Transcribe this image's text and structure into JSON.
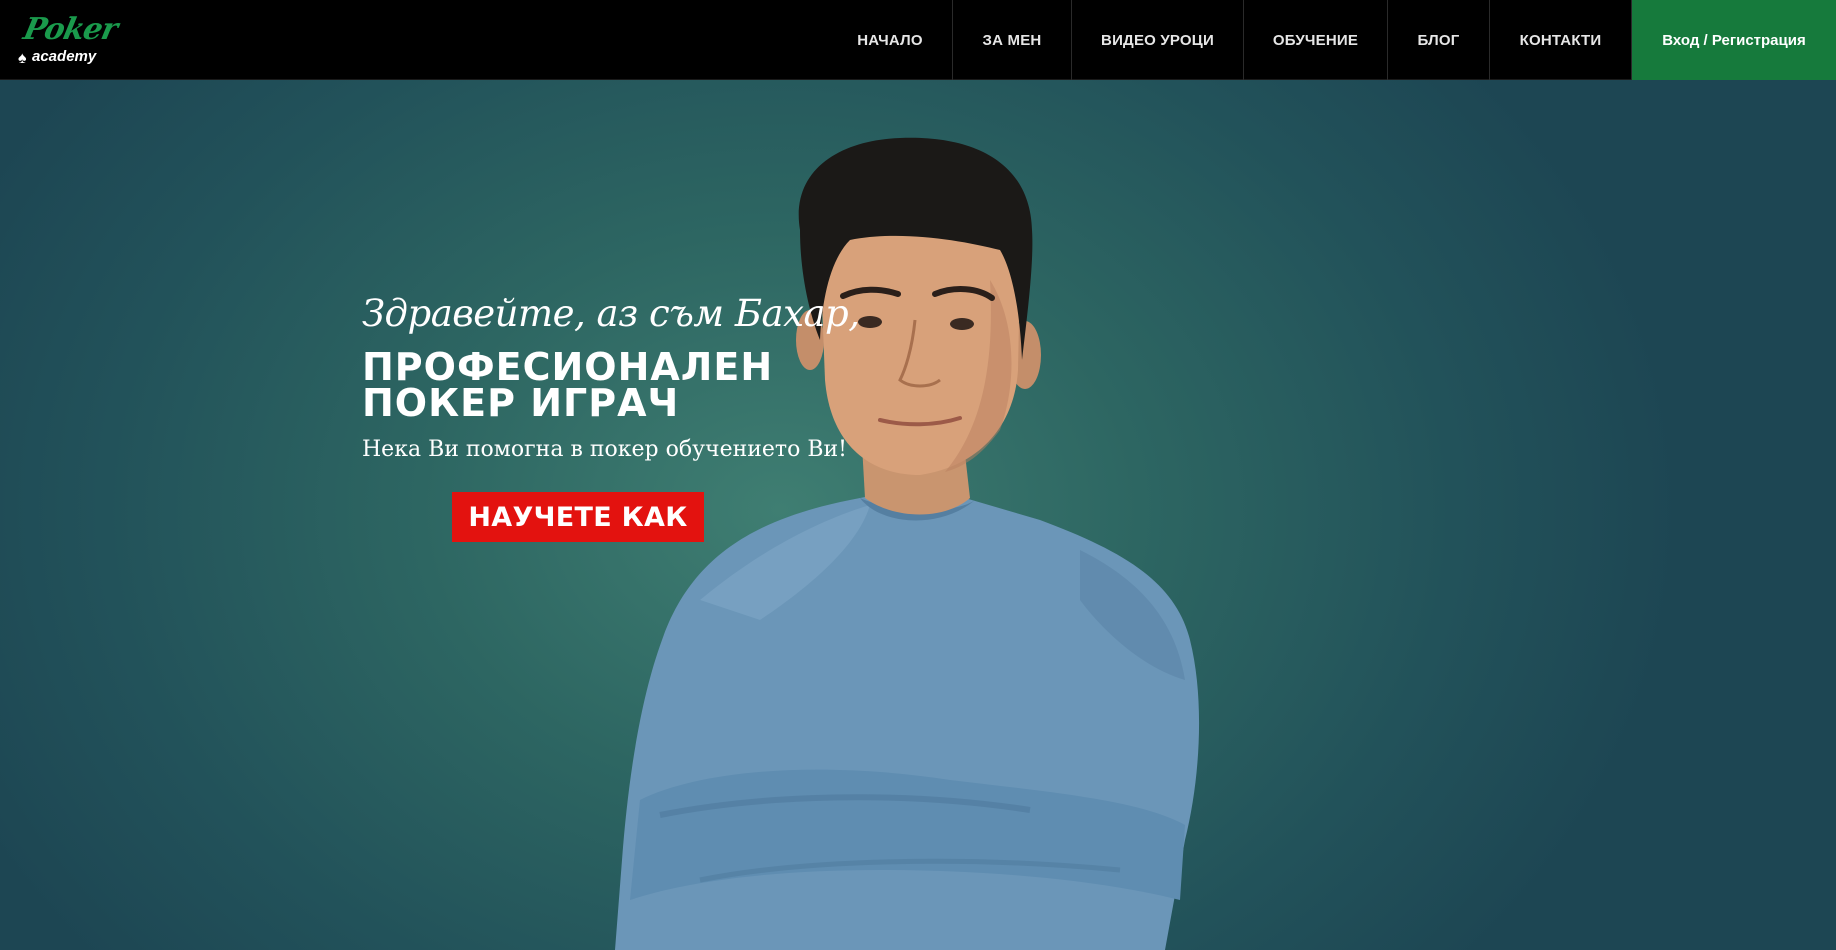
{
  "logo": {
    "script_text": "Poker",
    "sub_text": "academy"
  },
  "nav": {
    "items": [
      {
        "label": "НАЧАЛО"
      },
      {
        "label": "ЗА МЕН"
      },
      {
        "label": "ВИДЕО УРОЦИ"
      },
      {
        "label": "ОБУЧЕНИЕ"
      },
      {
        "label": "БЛОГ"
      },
      {
        "label": "КОНТАКТИ"
      }
    ],
    "login_label": "Вход / Регистрация"
  },
  "hero": {
    "greeting": "Здравейте, аз съм Бахар,",
    "headline_line1": "ПРОФЕСИОНАЛЕН",
    "headline_line2": "ПОКЕР ИГРАЧ",
    "subline": "Нека Ви помогна в покер обучението Ви!",
    "cta_label": "НАУЧЕТЕ КАК"
  },
  "colors": {
    "topbar": "#000000",
    "login_button": "#167a3c",
    "cta_button": "#e3120f",
    "hero_background": "#2d6662",
    "sweater": "#6b96b8"
  }
}
